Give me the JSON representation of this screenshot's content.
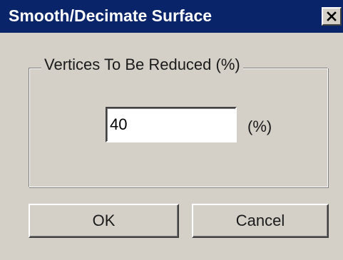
{
  "window": {
    "title": "Smooth/Decimate Surface",
    "close_icon": "close-icon"
  },
  "group": {
    "label": "Vertices To Be Reduced (%)"
  },
  "input": {
    "value": "40",
    "unit": "(%)"
  },
  "buttons": {
    "ok_label": "OK",
    "cancel_label": "Cancel"
  },
  "colors": {
    "titlebar": "#0a246a",
    "title_text": "#ffffff",
    "dialog_face": "#d4d0c8"
  }
}
